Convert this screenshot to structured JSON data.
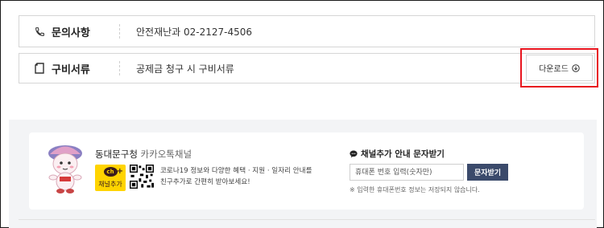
{
  "info_rows": [
    {
      "icon": "phone-icon",
      "label": "문의사항",
      "value": "안전재난과 02-2127-4506"
    },
    {
      "icon": "document-icon",
      "label": "구비서류",
      "value": "공제금 청구 시 구비서류"
    }
  ],
  "download": {
    "label": "다운로드",
    "icon": "cloud-download-icon",
    "highlight_color": "#e8141e"
  },
  "kakao": {
    "title_main": "동대문구청",
    "title_accent": " 카카오톡채널",
    "badge_label": "채널추가",
    "badge_mark": "ch",
    "desc_line1": "코로나19 정보와 다양한 혜택 · 지원 · 일자리 안내를",
    "desc_line2": "친구추가로 간편히 받아보세요!",
    "add_title": "채널추가 안내 문자받기",
    "input_placeholder": "휴대폰 번호 입력(숫자만)",
    "submit_label": "문자받기",
    "note": "※ 입력한 휴대폰번호 정보는 저장되지 않습니다.",
    "brand_yellow": "#ffd400",
    "button_color": "#3b4a6b"
  }
}
